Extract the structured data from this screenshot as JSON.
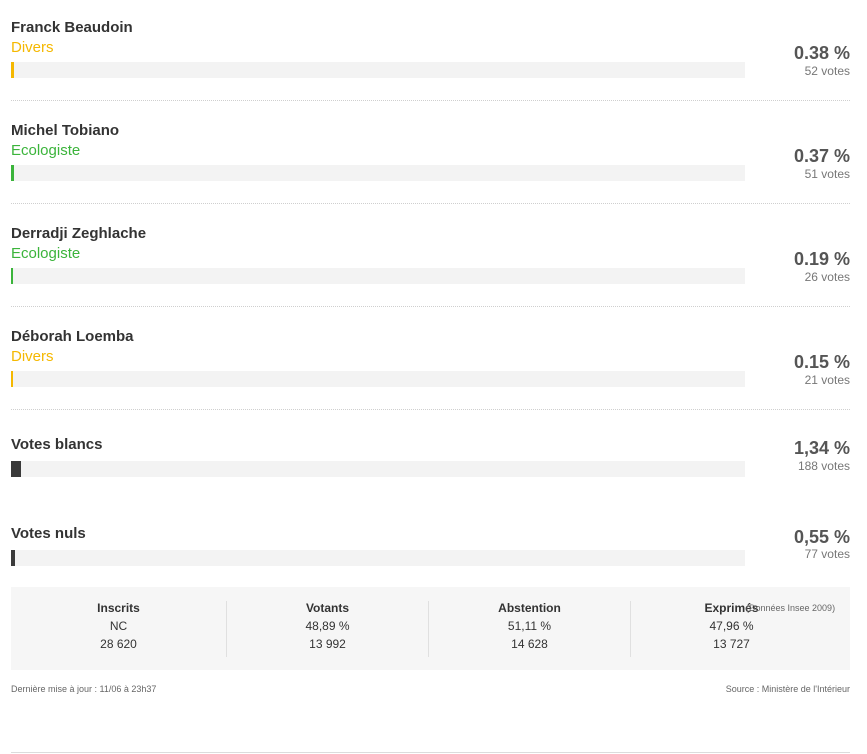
{
  "candidates": [
    {
      "name": "Franck Beaudoin",
      "party": "Divers",
      "party_color": "#f5b800",
      "pct": "0.38 %",
      "votes": "52 votes",
      "share": 0.38
    },
    {
      "name": "Michel Tobiano",
      "party": "Ecologiste",
      "party_color": "#3bb43b",
      "pct": "0.37 %",
      "votes": "51 votes",
      "share": 0.37
    },
    {
      "name": "Derradji Zeghlache",
      "party": "Ecologiste",
      "party_color": "#3bb43b",
      "pct": "0.19 %",
      "votes": "26 votes",
      "share": 0.19
    },
    {
      "name": "Déborah Loemba",
      "party": "Divers",
      "party_color": "#f5b800",
      "pct": "0.15 %",
      "votes": "21 votes",
      "share": 0.15
    }
  ],
  "blancs": {
    "name": "Votes blancs",
    "pct": "1,34 %",
    "votes": "188 votes",
    "share": 1.34,
    "color": "#3a3a3a"
  },
  "nuls": {
    "name": "Votes nuls",
    "pct": "0,55 %",
    "votes": "77 votes",
    "share": 0.55,
    "color": "#3a3a3a"
  },
  "summary": [
    {
      "label": "Inscrits",
      "pct": "NC",
      "count": "28 620"
    },
    {
      "label": "Votants",
      "pct": "48,89 %",
      "count": "13 992"
    },
    {
      "label": "Abstention",
      "pct": "51,11 %",
      "count": "14 628"
    },
    {
      "label": "Exprimés",
      "pct": "47,96 %",
      "count": "13 727"
    }
  ],
  "summary_note": "(Données Insee 2009)",
  "footer": {
    "updated": "Dernière mise à jour : 11/06 à 23h37",
    "source": "Source : Ministère de l'Intérieur"
  }
}
